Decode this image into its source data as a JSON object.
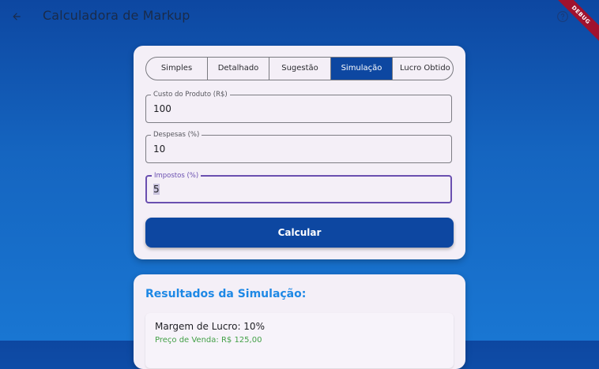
{
  "appbar": {
    "title": "Calculadora de Markup",
    "back_icon": "arrow-left-icon",
    "help_icon": "help-circle-icon",
    "debug_banner": "DEBUG"
  },
  "tabs": [
    {
      "label": "Simples",
      "active": false
    },
    {
      "label": "Detalhado",
      "active": false
    },
    {
      "label": "Sugestão",
      "active": false
    },
    {
      "label": "Simulação",
      "active": true
    },
    {
      "label": "Lucro Obtido",
      "active": false
    }
  ],
  "form": {
    "custo": {
      "label": "Custo do Produto (R$)",
      "value": "100"
    },
    "despesas": {
      "label": "Despesas (%)",
      "value": "10"
    },
    "impostos": {
      "label": "Impostos (%)",
      "value": "5"
    },
    "calcular_label": "Calcular"
  },
  "results": {
    "title": "Resultados da Simulação:",
    "items": [
      {
        "margin": "Margem de Lucro: 10%",
        "price": "Preço de Venda: R$ 125,00"
      }
    ]
  },
  "colors": {
    "primary": "#0d47a1",
    "accent_title": "#1e88e5",
    "price_green": "#43a047",
    "focus_purple": "#6a4fb0",
    "debug_red": "#a0122e"
  }
}
